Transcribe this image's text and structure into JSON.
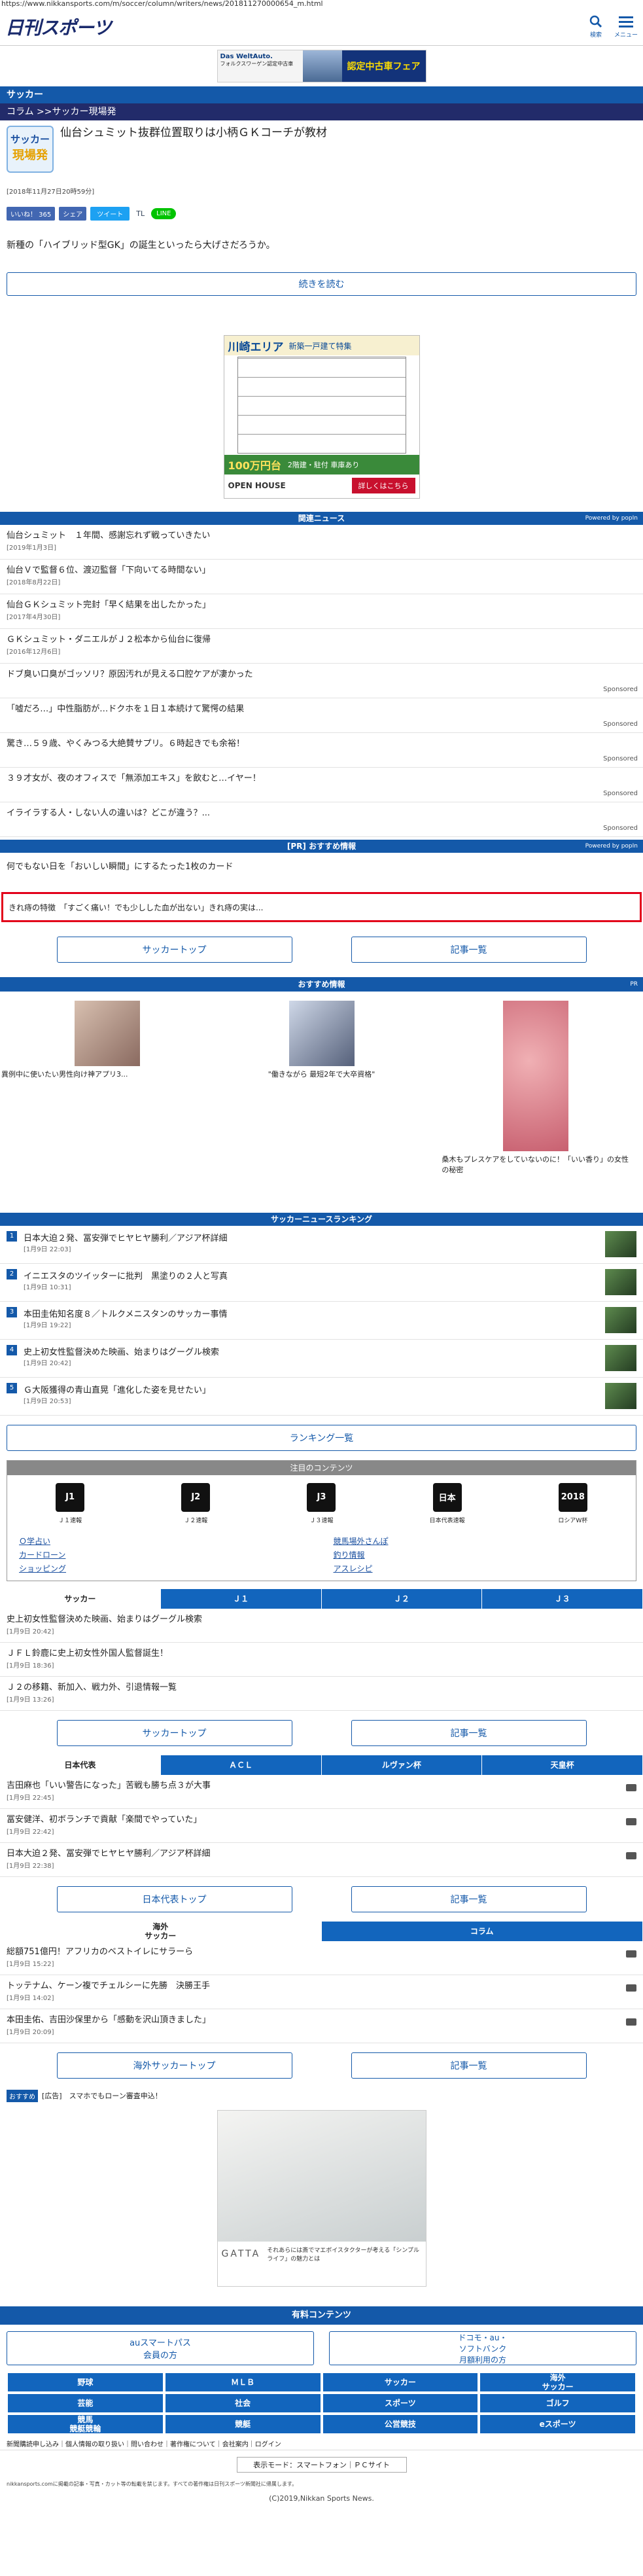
{
  "browser": {
    "url": "https://www.nikkansports.com/m/soccer/column/writers/news/201811270000654_m.html"
  },
  "header": {
    "logo": "日刊スポーツ",
    "search_label": "検索",
    "menu_label": "メニュー"
  },
  "top_ad": {
    "brand": "Das WeltAuto.",
    "sub": "フォルクスワーゲン認定中古車",
    "text": "認定中古車フェア"
  },
  "section_bar": "サッカー",
  "breadcrumb": "コラム >>サッカー現場発",
  "column": {
    "badge_line1": "サッカー",
    "badge_line2": "現場発",
    "title": "仙台シュミット抜群位置取りは小柄ＧＫコーチが教材"
  },
  "article": {
    "date": "[2018年11月27日20時59分]",
    "body": "新種の「ハイブリッド型GK」の誕生といったら大げさだろうか。",
    "read_more": "続きを読む"
  },
  "social": {
    "like": "いいね！ 365",
    "share": "シェア",
    "tweet": "ツイート",
    "line": "LINE"
  },
  "house_ad": {
    "title": "川崎エリア",
    "sub": "新築一戸建て特集",
    "price": "100万円台",
    "terms": "2階建・駐付 車庫あり",
    "open": "OPEN HOUSE",
    "detail": "詳しくはこちら"
  },
  "related": {
    "heading": "関連ニュース",
    "powered": "Powered by popIn",
    "items": [
      {
        "title": "仙台シュミット　１年間、感謝忘れず戦っていきたい",
        "date": "[2019年1月3日]"
      },
      {
        "title": "仙台Ｖで監督６位、渡辺監督「下向いてる時間ない」",
        "date": "[2018年8月22日]"
      },
      {
        "title": "仙台ＧＫシュミット完封「早く結果を出したかった」",
        "date": "[2017年4月30日]"
      },
      {
        "title": "ＧＫシュミット・ダニエルがＪ２松本から仙台に復帰",
        "date": "[2016年12月6日]"
      }
    ],
    "sponsored": [
      {
        "title": "ドブ臭い口臭がゴッソリ？原因汚れが見える口腔ケアが凄かった",
        "label": "Sponsored"
      },
      {
        "title": "「嘘だろ…」中性脂肪が…ドクホを１日１本続けて驚愕の結果",
        "label": "Sponsored"
      },
      {
        "title": "驚き…５９歳、やくみつる大絶賛サプリ。６時起きでも余裕！",
        "label": "Sponsored"
      },
      {
        "title": "３９才女が、夜のオフィスで「無添加エキス」を飲むと…イヤー！",
        "label": "Sponsored"
      },
      {
        "title": "イライラする人・しない人の違いは？どこが違う？...",
        "label": "Sponsored"
      }
    ]
  },
  "pr": {
    "heading": "[PR] おすすめ情報",
    "powered": "Powered by popIn",
    "item": "何でもない日を「おいしい瞬間」にするたった1枚のカード",
    "highlight": "きれ痔の特徴　「すごく痛い！でも少しした血が出ない」きれ痔の実は..."
  },
  "nav_buttons": {
    "soccer_top": "サッカートップ",
    "articles": "記事一覧"
  },
  "recommend": {
    "heading": "おすすめ情報",
    "pr": "PR",
    "items": [
      {
        "caption": "異例中に使いたい男性向け神アプリ3..."
      },
      {
        "caption": "\"働きながら 最短2年で大卒資格\""
      },
      {
        "caption": "桑木もプレスケアをしていないのに！「いい香り」の女性の秘密"
      }
    ]
  },
  "ranking": {
    "heading": "サッカーニュースランキング",
    "more": "ランキング一覧",
    "items": [
      {
        "rank": "1",
        "title": "日本大迫２発、冨安弾でヒヤヒヤ勝利／アジア杯詳細",
        "date": "[1月9日 22:03]"
      },
      {
        "rank": "2",
        "title": "イニエスタのツイッターに批判　黒塗りの２人と写真",
        "date": "[1月9日 10:31]"
      },
      {
        "rank": "3",
        "title": "本田圭佑知名度８／トルクメニスタンのサッカー事情",
        "date": "[1月9日 19:22]"
      },
      {
        "rank": "4",
        "title": "史上初女性監督決めた映画、始まりはグーグル検索",
        "date": "[1月9日 20:42]"
      },
      {
        "rank": "5",
        "title": "Ｇ大阪獲得の青山直晃「進化した姿を見せたい」",
        "date": "[1月9日 20:53]"
      }
    ]
  },
  "attention": {
    "heading": "注目のコンテンツ",
    "icons": [
      {
        "icon": "J1",
        "label": "Ｊ１速報"
      },
      {
        "icon": "J2",
        "label": "Ｊ２速報"
      },
      {
        "icon": "J3",
        "label": "Ｊ３速報"
      },
      {
        "icon": "日本",
        "label": "日本代表速報"
      },
      {
        "icon": "2018",
        "label": "ロシアW杯"
      }
    ],
    "links": [
      "Ｏ学占い",
      "競馬場外さんぽ",
      "カードローン",
      "釣り情報",
      "ショッピング",
      "アスレシピ"
    ]
  },
  "tabs1": {
    "tabs": [
      "サッカー",
      "Ｊ１",
      "Ｊ２",
      "Ｊ３"
    ],
    "items": [
      {
        "title": "史上初女性監督決めた映画、始まりはグーグル検索",
        "date": "[1月9日 20:42]"
      },
      {
        "title": "ＪＦＬ鈴鹿に史上初女性外国人監督誕生！",
        "date": "[1月9日 18:36]"
      },
      {
        "title": "Ｊ２の移籍、新加入、戦力外、引退情報一覧",
        "date": "[1月9日 13:26]"
      }
    ]
  },
  "tabs2": {
    "tabs": [
      "日本代表",
      "ＡＣＬ",
      "ルヴァン杯",
      "天皇杯"
    ],
    "items": [
      {
        "title": "吉田麻也「いい警告になった」苦戦も勝ち点３が大事",
        "date": "[1月9日 22:45]"
      },
      {
        "title": "冨安健洋、初ボランチで貢献「楽間でやっていた」",
        "date": "[1月9日 22:42]"
      },
      {
        "title": "日本大迫２発、冨安弾でヒヤヒヤ勝利／アジア杯詳細",
        "date": "[1月9日 22:38]"
      }
    ],
    "top": "日本代表トップ",
    "list": "記事一覧"
  },
  "tabs3": {
    "tabs": [
      "海外\nサッカー",
      "コラム"
    ],
    "items": [
      {
        "title": "総額751億円！アフリカのベストイレにサラーら",
        "date": "[1月9日 15:22]"
      },
      {
        "title": "トッテナム、ケーン複でチェルシーに先勝　決勝王手",
        "date": "[1月9日 14:02]"
      },
      {
        "title": "本田圭佑、吉田沙保里から「感動を沢山頂きました」",
        "date": "[1月9日 20:09]"
      }
    ],
    "top": "海外サッカートップ",
    "list": "記事一覧"
  },
  "recommend2": {
    "badge": "おすすめ",
    "text": "[広告]　スマホでもローン審査申込！"
  },
  "gatta": {
    "brand": "GATTA",
    "text": "それあらには斎でマエボイスタクターが考える「シンプルライフ」の魅力とは"
  },
  "paid": {
    "heading": "有料コンテンツ",
    "au": "auスマートパス\n会員の方",
    "docomo": "ドコモ・au・\nソフトバンク\n月額利用の方"
  },
  "footer_grid": [
    [
      "野球",
      "ＭＬＢ",
      "サッカー",
      "海外\nサッカー"
    ],
    [
      "芸能",
      "社会",
      "スポーツ",
      "ゴルフ"
    ],
    [
      "競馬\n競艇競輪",
      "競艇",
      "公営競技",
      "eスポーツ"
    ]
  ],
  "footer_links": "新聞購読申し込み｜個人情報の取り扱い｜問い合わせ｜著作権について｜会社案内｜ログイン",
  "display_mode": "表示モード：スマートフォン｜ＰＣサイト",
  "copyright_note": "nikkansports.comに掲載の記事・写真・カット等の転載を禁じます。すべての著作権は日刊スポーツ新聞社に帰属します。",
  "copyright": "(C)2019,Nikkan Sports News."
}
